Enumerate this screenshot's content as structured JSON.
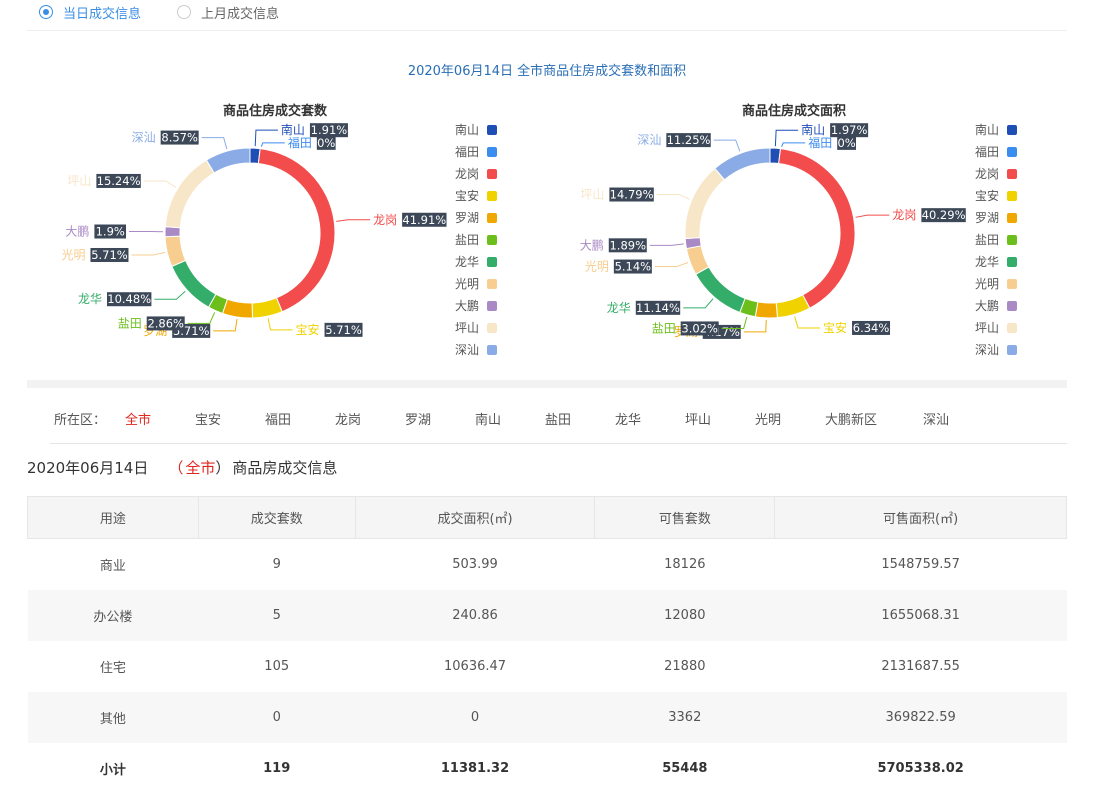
{
  "radio_options": [
    {
      "label": "当日成交信息",
      "selected": true
    },
    {
      "label": "上月成交信息",
      "selected": false
    }
  ],
  "main_title": "2020年06月14日 全市商品住房成交套数和面积",
  "colors": {
    "南山": "#1f4fb5",
    "福田": "#3b8cf0",
    "龙岗": "#f24c4c",
    "宝安": "#f0d200",
    "罗湖": "#f0a800",
    "盐田": "#6cbf1a",
    "龙华": "#35ad6a",
    "光明": "#f8cd90",
    "大鹏": "#a98ac4",
    "坪山": "#f8e6c8",
    "深汕": "#8aabe6"
  },
  "legend": [
    "南山",
    "福田",
    "龙岗",
    "宝安",
    "罗湖",
    "盐田",
    "龙华",
    "光明",
    "大鹏",
    "坪山",
    "深汕"
  ],
  "chart_data": [
    {
      "type": "pie",
      "title": "商品住房成交套数",
      "categories": [
        "南山",
        "福田",
        "龙岗",
        "宝安",
        "罗湖",
        "盐田",
        "龙华",
        "光明",
        "大鹏",
        "坪山",
        "深汕"
      ],
      "values": [
        1.91,
        0,
        41.91,
        5.71,
        5.71,
        2.86,
        10.48,
        5.71,
        1.9,
        15.24,
        8.57
      ],
      "labels": [
        "1.91%",
        "0%",
        "41.91%",
        "5.71%",
        "5.71%",
        "2.86%",
        "10.48%",
        "5.71%",
        "1.9%",
        "15.24%",
        "8.57%"
      ]
    },
    {
      "type": "pie",
      "title": "商品住房成交面积",
      "categories": [
        "南山",
        "福田",
        "龙岗",
        "宝安",
        "罗湖",
        "盐田",
        "龙华",
        "光明",
        "大鹏",
        "坪山",
        "深汕"
      ],
      "values": [
        1.97,
        0,
        40.29,
        6.34,
        4.17,
        3.02,
        11.14,
        5.14,
        1.89,
        14.79,
        11.25
      ],
      "labels": [
        "1.97%",
        "0%",
        "40.29%",
        "6.34%",
        "4.17%",
        "3.02%",
        "11.14%",
        "5.14%",
        "1.89%",
        "14.79%",
        "11.25%"
      ]
    }
  ],
  "district_label": "所在区：",
  "districts": [
    {
      "label": "全市",
      "active": true
    },
    {
      "label": "宝安"
    },
    {
      "label": "福田"
    },
    {
      "label": "龙岗"
    },
    {
      "label": "罗湖"
    },
    {
      "label": "南山"
    },
    {
      "label": "盐田"
    },
    {
      "label": "龙华"
    },
    {
      "label": "坪山"
    },
    {
      "label": "光明"
    },
    {
      "label": "大鹏新区"
    },
    {
      "label": "深汕"
    }
  ],
  "info": {
    "date": "2020年06月14日",
    "open_paren": "（",
    "city": "全市",
    "close_paren": "）",
    "suffix": "商品房成交信息"
  },
  "table": {
    "headers": [
      "用途",
      "成交套数",
      "成交面积(㎡)",
      "可售套数",
      "可售面积(㎡)"
    ],
    "rows": [
      [
        "商业",
        "9",
        "503.99",
        "18126",
        "1548759.57"
      ],
      [
        "办公楼",
        "5",
        "240.86",
        "12080",
        "1655068.31"
      ],
      [
        "住宅",
        "105",
        "10636.47",
        "21880",
        "2131687.55"
      ],
      [
        "其他",
        "0",
        "0",
        "3362",
        "369822.59"
      ]
    ],
    "total": [
      "小计",
      "119",
      "11381.32",
      "55448",
      "5705338.02"
    ]
  }
}
